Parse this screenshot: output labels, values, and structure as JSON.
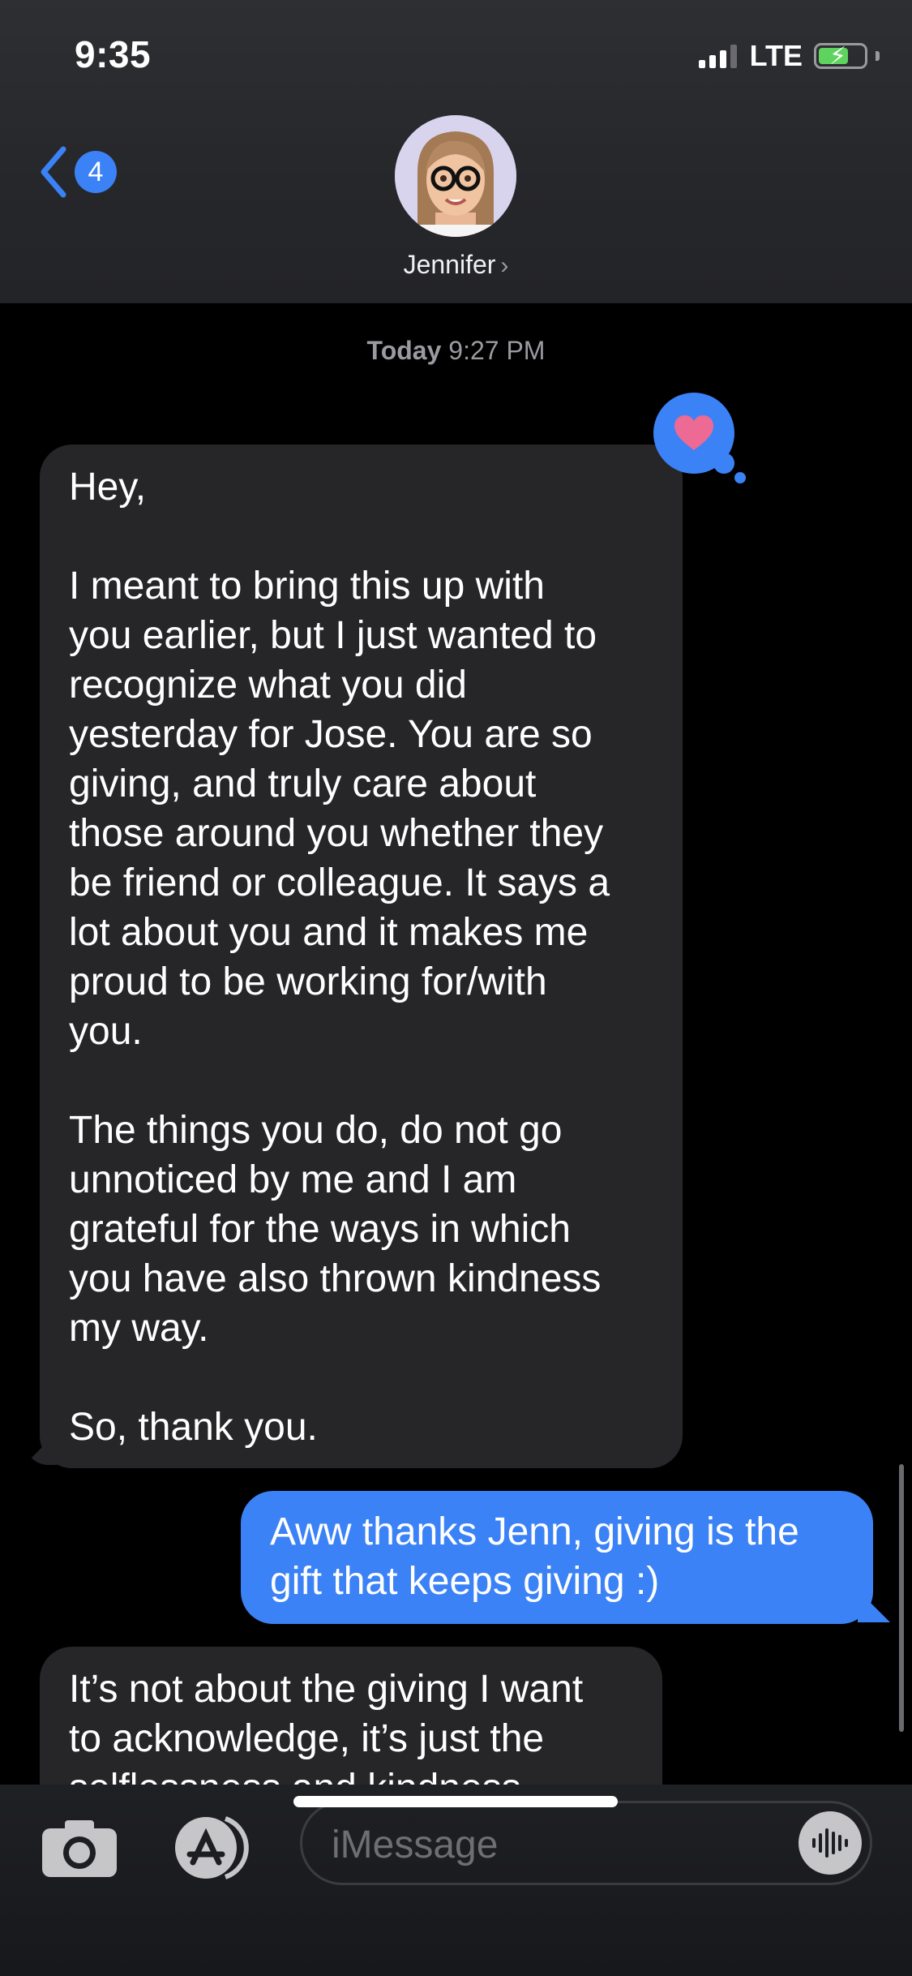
{
  "status_bar": {
    "time": "9:35",
    "network": "LTE"
  },
  "header": {
    "unread_count": "4",
    "contact_name": "Jennifer",
    "contact_chevron": "›"
  },
  "thread": {
    "timestamp_day": "Today",
    "timestamp_time": "9:27 PM",
    "messages": [
      {
        "direction": "incoming",
        "text": "Hey,\n\nI meant to bring this up with\nyou earlier, but I just wanted to\nrecognize what you did\nyesterday for Jose. You are so\ngiving, and truly care about\nthose around you whether they\nbe friend or colleague. It says a\nlot about you and it makes me\nproud to be working for/with\nyou.\n\nThe things you do, do not go\nunnoticed by me and I am\ngrateful for the ways in which\nyou have also thrown kindness\nmy way.\n\nSo, thank you.",
        "reaction": "heart-icon"
      },
      {
        "direction": "outgoing",
        "text": "Aww thanks Jenn, giving is the\ngift that keeps giving :)"
      },
      {
        "direction": "incoming",
        "text": "It’s not about the giving I want\nto acknowledge, it’s just the\nselflessness and kindness"
      }
    ]
  },
  "compose": {
    "placeholder": "iMessage"
  },
  "colors": {
    "accent": "#3b82f6",
    "incoming_bubble": "#262628",
    "heart": "#ec6a93",
    "battery": "#5ed35e"
  }
}
